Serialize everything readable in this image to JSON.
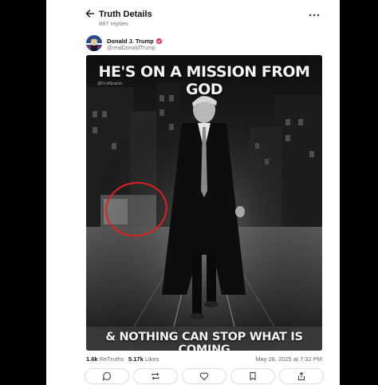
{
  "header": {
    "title": "Truth Details",
    "replies": "887 replies"
  },
  "author": {
    "name": "Donald J. Trump",
    "handle": "@realDonaldTrump"
  },
  "post_image": {
    "headline_top": "HE'S ON A MISSION FROM GOD",
    "headline_bottom": "& NOTHING CAN STOP WHAT IS COMING",
    "watermark": "@FruitSnacks"
  },
  "stats": {
    "retruths_count": "1.6k",
    "retruths_label": "ReTruths",
    "likes_count": "5.17k",
    "likes_label": "Likes",
    "date": "May 28, 2025 at 7:32 PM"
  },
  "actions": [
    "reply",
    "retruth",
    "like",
    "bookmark",
    "share"
  ],
  "colors": {
    "verified": "#e0245e",
    "annotation_circle": "#e02020",
    "background": "#000000",
    "panel": "#ffffff"
  }
}
